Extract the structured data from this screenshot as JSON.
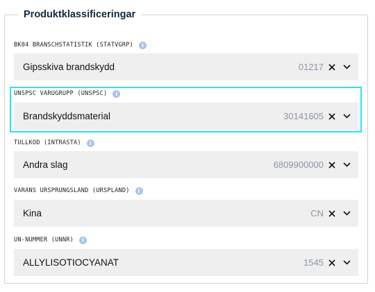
{
  "section": {
    "title": "Produktklassificeringar"
  },
  "fields": [
    {
      "label": "BK04 BRANSCHSTATISTIK (STATVGRP)",
      "value": "Gipsskiva brandskydd",
      "code": "01217"
    },
    {
      "label": "UNSPSC VARUGRUPP (UNSPSC)",
      "value": "Brandskyddsmaterial",
      "code": "30141605"
    },
    {
      "label": "TULLKOD (INTRASTA)",
      "value": "Andra slag",
      "code": "6809900000"
    },
    {
      "label": "VARANS URSPRUNGSLAND (URSPLAND)",
      "value": "Kina",
      "code": "CN"
    },
    {
      "label": "UN-NUMMER (UNNR)",
      "value": "ALLYLISOTIOCYANAT",
      "code": "1545"
    }
  ],
  "icons": {
    "info": "info-icon",
    "clear": "close-icon",
    "expand": "chevron-down-icon"
  },
  "colors": {
    "highlight": "#22e6f2",
    "info": "#a9c5e6",
    "field_bg": "#f0efef"
  }
}
